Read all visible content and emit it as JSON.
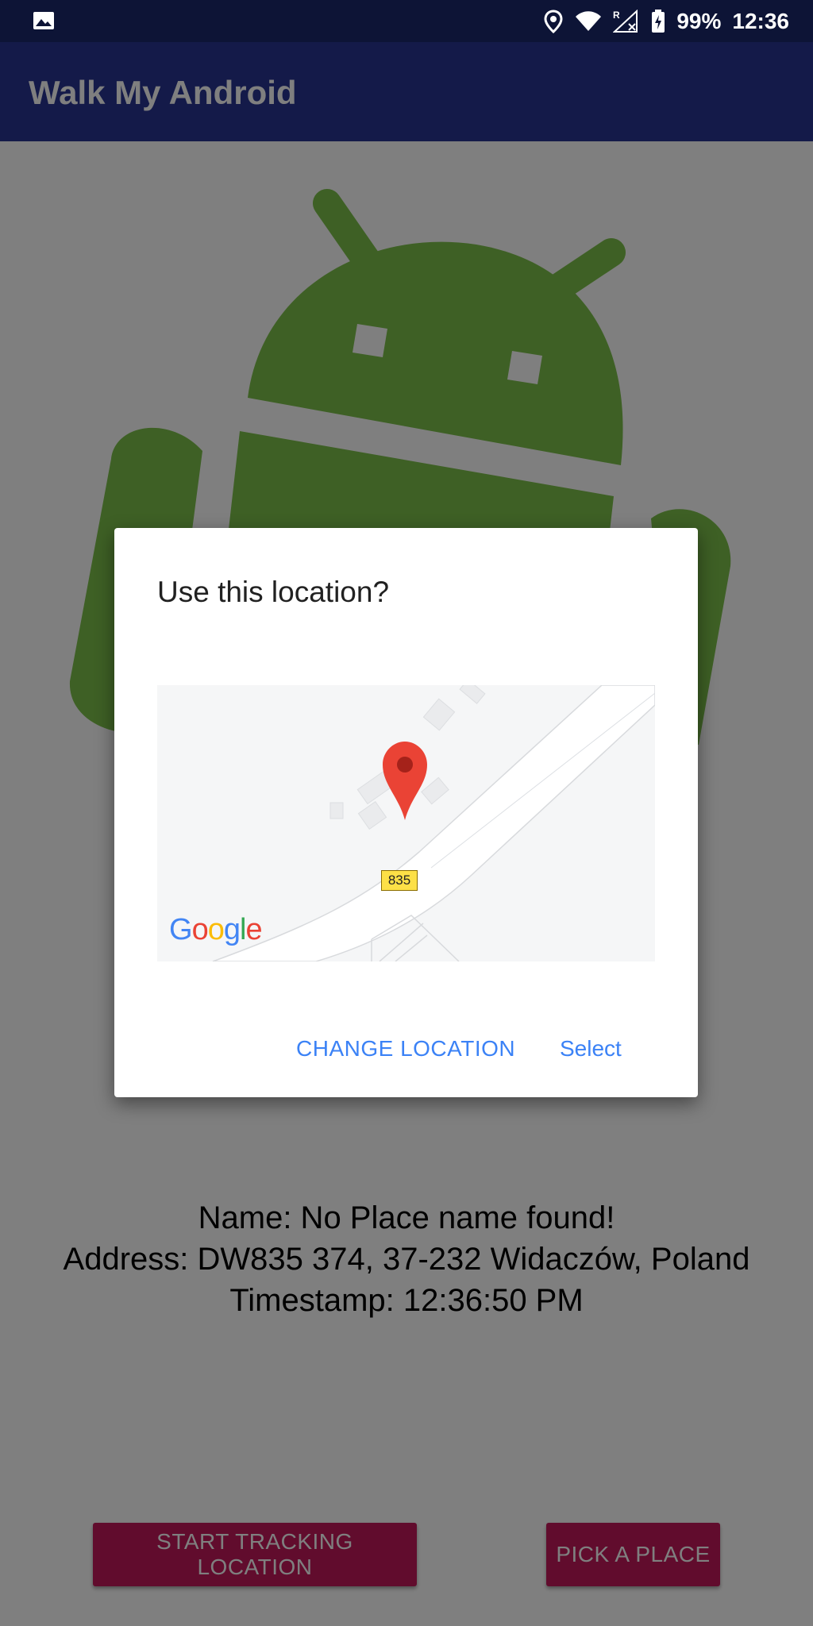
{
  "status_bar": {
    "battery": "99%",
    "time": "12:36"
  },
  "app_bar": {
    "title": "Walk My Android"
  },
  "info": {
    "name_line": "Name: No Place name found!",
    "address_line": "Address: DW835 374, 37-232 Widaczów, Poland",
    "timestamp_line": "Timestamp: 12:36:50 PM"
  },
  "buttons": {
    "start_tracking": "START TRACKING LOCATION",
    "pick_place": "PICK A PLACE"
  },
  "dialog": {
    "title": "Use this location?",
    "map": {
      "road_label": "835",
      "logo": "Google"
    },
    "actions": {
      "change_location": "CHANGE LOCATION",
      "select": "Select"
    }
  },
  "colors": {
    "status_bar": "#0d1436",
    "app_bar": "#283593",
    "android_green": "#7cc04b",
    "button": "#c2185b",
    "dialog_action": "#3b82f6",
    "map_pin": "#ea4335"
  }
}
